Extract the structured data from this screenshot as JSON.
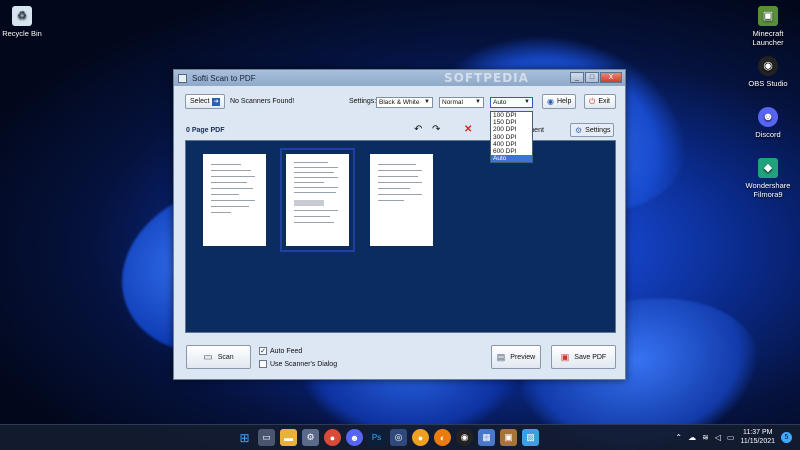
{
  "desktop": {
    "left_icons": [
      {
        "label": "Recycle Bin",
        "icon": "recycle-bin-icon"
      }
    ],
    "right_icons": [
      {
        "label": "Minecraft Launcher",
        "icon": "minecraft-icon"
      },
      {
        "label": "OBS Studio",
        "icon": "obs-icon"
      },
      {
        "label": "Discord",
        "icon": "discord-icon"
      },
      {
        "label": "Wondershare Filmora9",
        "icon": "filmora-icon"
      }
    ]
  },
  "window": {
    "title": "Softi Scan to PDF",
    "watermark": "SOFTPEDIA",
    "controls": {
      "minimize": "_",
      "maximize": "□",
      "close": "X"
    }
  },
  "toolbar": {
    "select_label": "Select",
    "scanner_status": "No Scanners Found!",
    "settings_label": "Settings:",
    "color_mode": "Black & White",
    "quality": "Normal",
    "dpi": "Auto",
    "help_label": "Help",
    "exit_label": "Exit"
  },
  "dpi_options": [
    "100 DPI",
    "150 DPI",
    "200 DPI",
    "300 DPI",
    "400 DPI",
    "600 DPI",
    "Auto"
  ],
  "subbar": {
    "page_count": "0 Page PDF",
    "document_label": "Document",
    "settings_label": "Settings"
  },
  "bottom": {
    "scan_label": "Scan",
    "auto_feed": "Auto Feed",
    "auto_feed_checked": true,
    "use_dialog": "Use Scanner's Dialog",
    "use_dialog_checked": false,
    "preview_label": "Preview",
    "save_label": "Save PDF"
  },
  "taskbar": {
    "time": "11:37 PM",
    "date": "11/15/2021",
    "notification_count": "5"
  },
  "colors": {
    "canvas": "#0b2c5e",
    "accent": "#3a74d8"
  }
}
